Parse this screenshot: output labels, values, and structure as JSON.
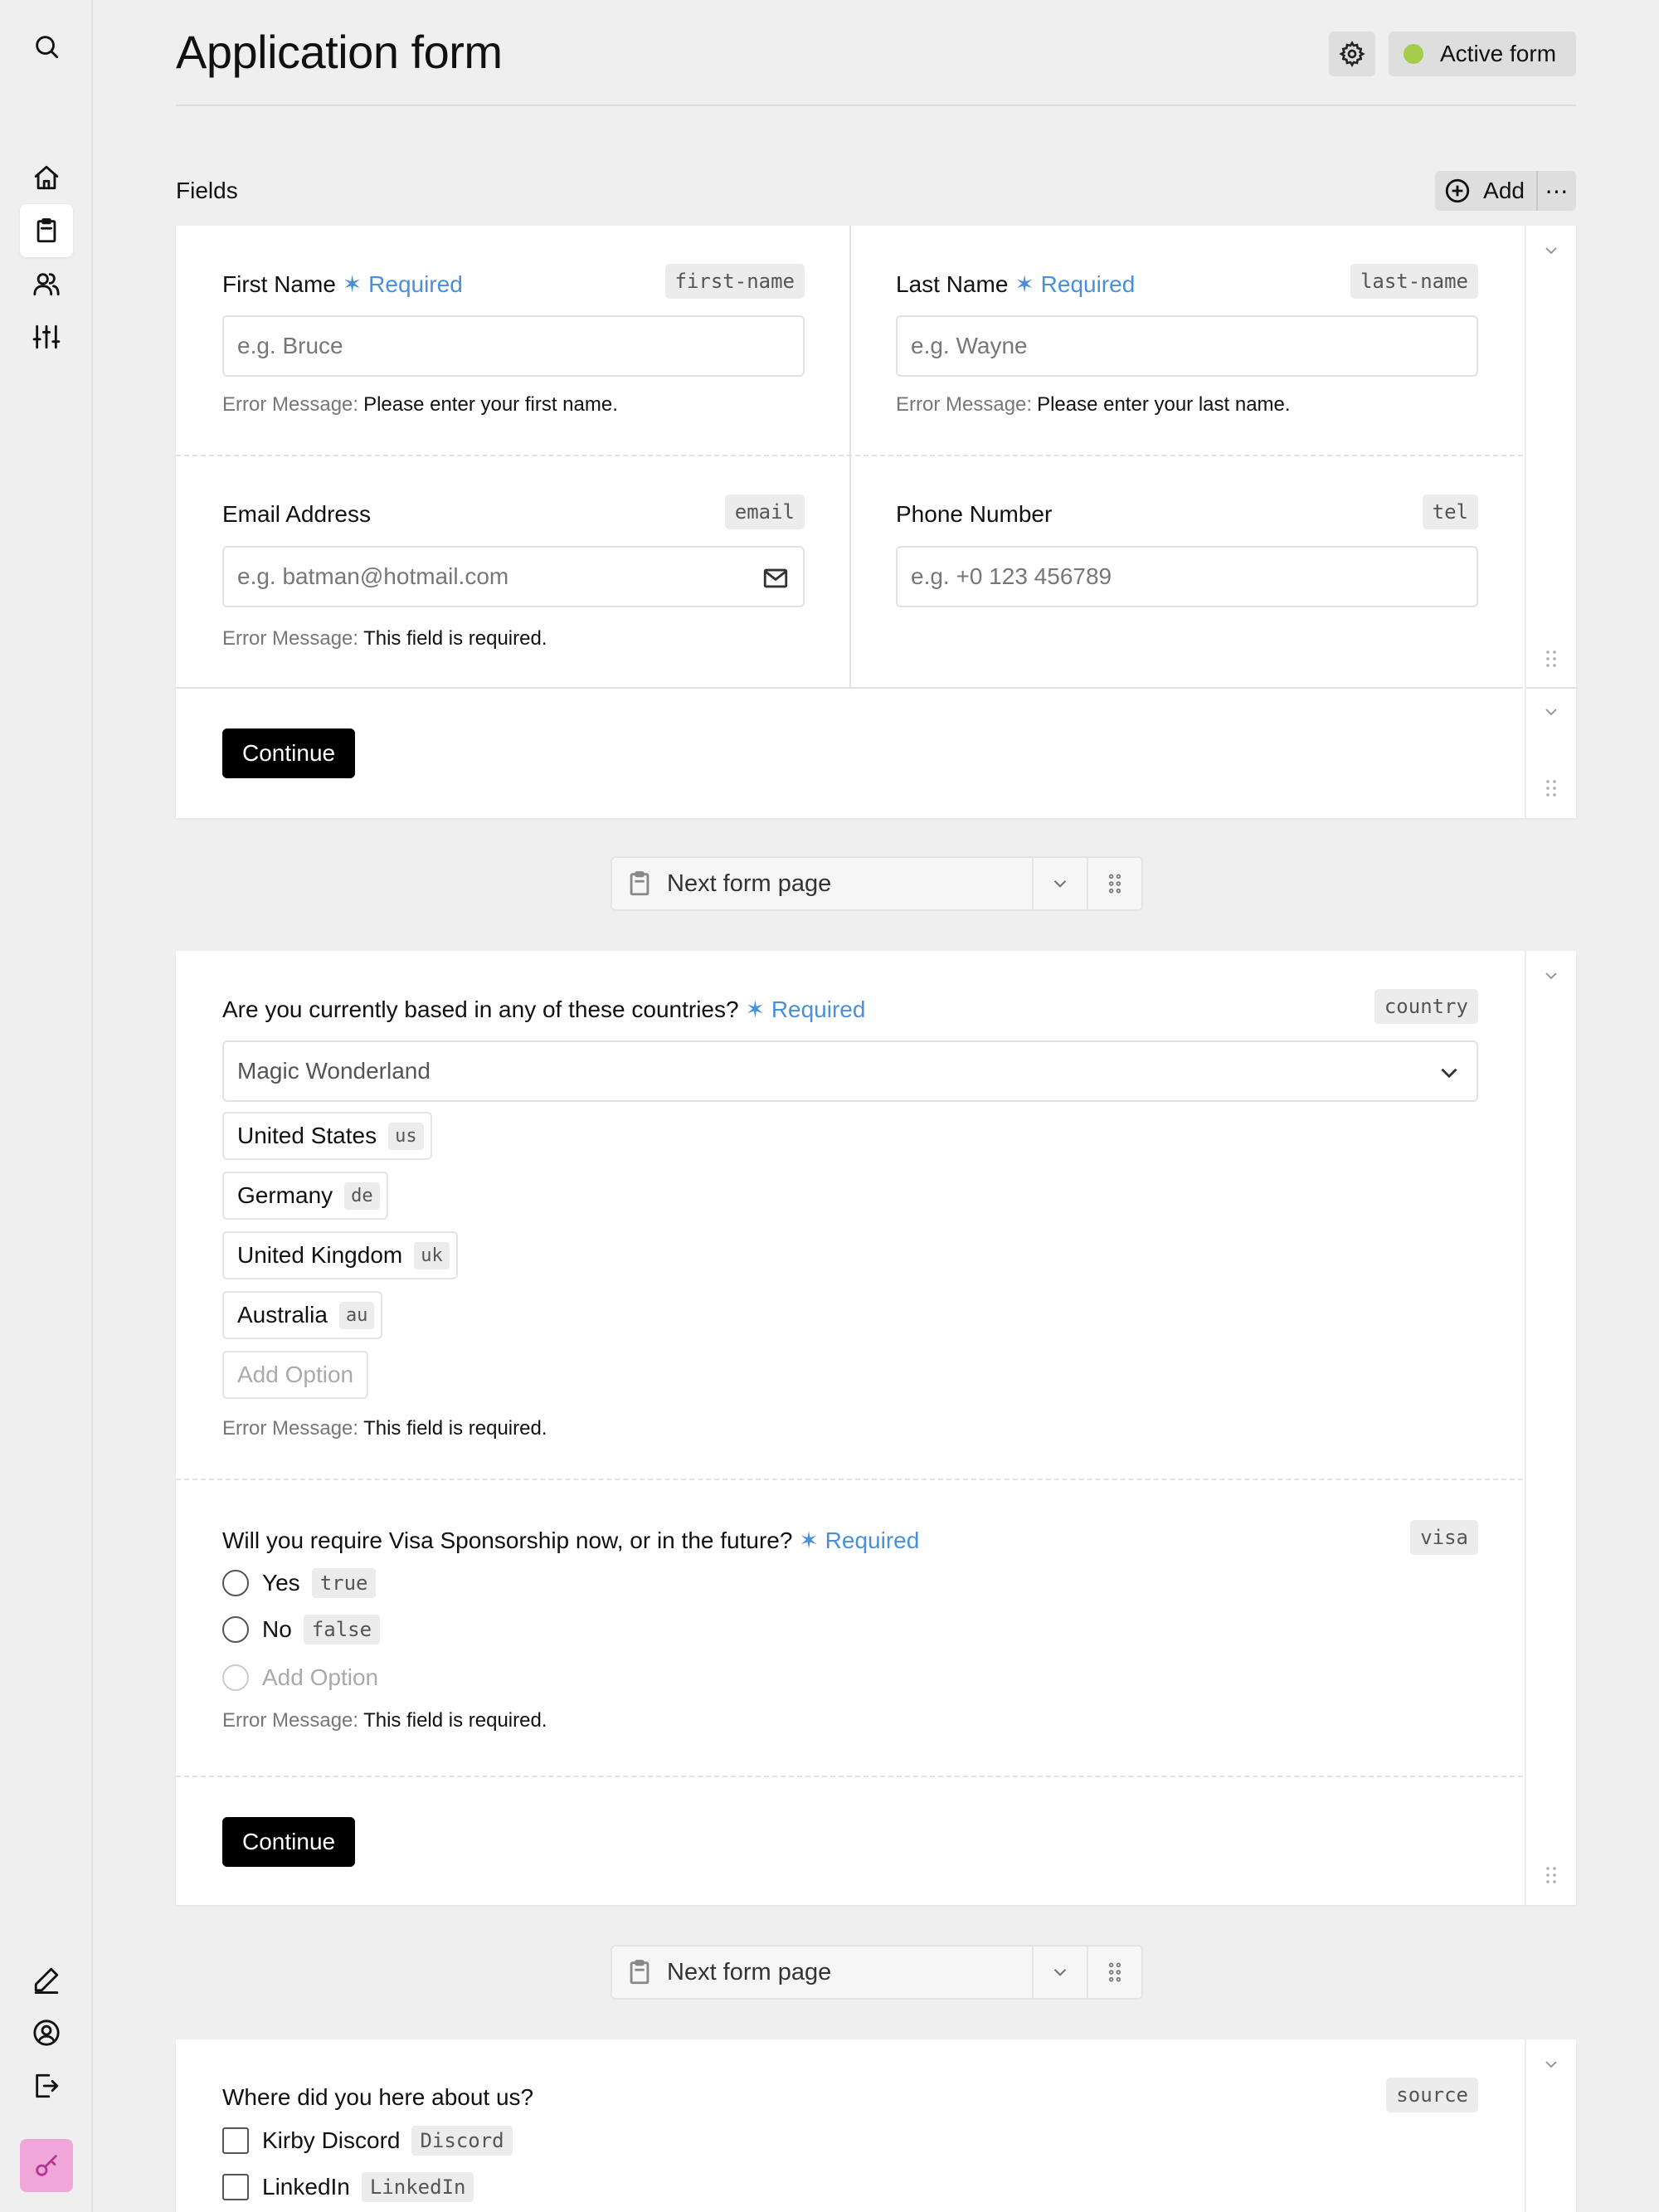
{
  "page": {
    "title": "Application form",
    "status_label": "Active form",
    "status_color": "#a4cd4a"
  },
  "sidebar": {
    "icons": [
      "search-icon",
      "home-icon",
      "clipboard-icon",
      "users-icon",
      "sliders-icon",
      "pen-icon",
      "user-circle-icon",
      "logout-icon",
      "key-icon"
    ]
  },
  "section": {
    "title": "Fields",
    "add_label": "Add",
    "more_label": "⋯"
  },
  "page1": {
    "first_name": {
      "label": "First Name",
      "required": "✶ Required",
      "key": "first-name",
      "placeholder": "e.g. Bruce",
      "error_key": "Error Message:",
      "error_text": "Please enter your first name."
    },
    "last_name": {
      "label": "Last Name",
      "required": "✶ Required",
      "key": "last-name",
      "placeholder": "e.g. Wayne",
      "error_key": "Error Message:",
      "error_text": "Please enter your last name."
    },
    "email": {
      "label": "Email Address",
      "key": "email",
      "placeholder": "e.g. batman@hotmail.com",
      "error_key": "Error Message:",
      "error_text": "This field is required."
    },
    "phone": {
      "label": "Phone Number",
      "key": "tel",
      "placeholder": "e.g. +0 123 456789"
    },
    "continue_label": "Continue"
  },
  "next_page_label": "Next form page",
  "page2": {
    "country": {
      "label": "Are you currently based in any of these countries?",
      "required": "✶ Required",
      "key": "country",
      "select_value": "Magic Wonderland",
      "options": [
        {
          "label": "United States",
          "value": "us"
        },
        {
          "label": "Germany",
          "value": "de"
        },
        {
          "label": "United Kingdom",
          "value": "uk"
        },
        {
          "label": "Australia",
          "value": "au"
        }
      ],
      "add_option": "Add Option",
      "error_key": "Error Message:",
      "error_text": "This field is required."
    },
    "visa": {
      "label": "Will you require Visa Sponsorship now, or in the future?",
      "required": "✶ Required",
      "key": "visa",
      "options": [
        {
          "label": "Yes",
          "value": "true"
        },
        {
          "label": "No",
          "value": "false"
        }
      ],
      "add_option": "Add Option",
      "error_key": "Error Message:",
      "error_text": "This field is required."
    },
    "continue_label": "Continue"
  },
  "page3": {
    "source": {
      "label": "Where did you here about us?",
      "key": "source",
      "options": [
        {
          "label": "Kirby Discord",
          "value": "Discord"
        },
        {
          "label": "LinkedIn",
          "value": "LinkedIn"
        }
      ]
    }
  }
}
